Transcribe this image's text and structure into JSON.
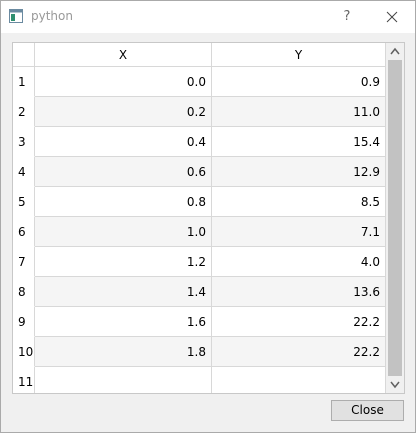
{
  "window": {
    "title": "python",
    "help_label": "?",
    "close_icon": "close-icon",
    "app_icon": "app-window-icon"
  },
  "table": {
    "columns": [
      "X",
      "Y"
    ],
    "rows": [
      {
        "num": "1",
        "x": "0.0",
        "y": "0.9"
      },
      {
        "num": "2",
        "x": "0.2",
        "y": "11.0"
      },
      {
        "num": "3",
        "x": "0.4",
        "y": "15.4"
      },
      {
        "num": "4",
        "x": "0.6",
        "y": "12.9"
      },
      {
        "num": "5",
        "x": "0.8",
        "y": "8.5"
      },
      {
        "num": "6",
        "x": "1.0",
        "y": "7.1"
      },
      {
        "num": "7",
        "x": "1.2",
        "y": "4.0"
      },
      {
        "num": "8",
        "x": "1.4",
        "y": "13.6"
      },
      {
        "num": "9",
        "x": "1.6",
        "y": "22.2"
      },
      {
        "num": "10",
        "x": "1.8",
        "y": "22.2"
      },
      {
        "num": "11",
        "x": "",
        "y": ""
      }
    ],
    "scroll_up_icon": "chevron-up-icon",
    "scroll_down_icon": "chevron-down-icon"
  },
  "footer": {
    "close_label": "Close"
  }
}
